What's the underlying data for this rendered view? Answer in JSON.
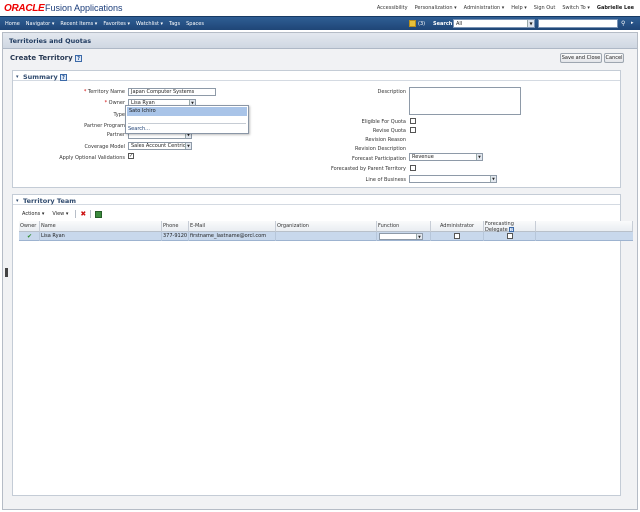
{
  "banner": {
    "logo": "ORACLE",
    "product": "Fusion Applications",
    "links": [
      "Accessibility",
      "Personalization ▾",
      "Administration ▾",
      "Help ▾",
      "Sign Out",
      "Switch To ▾"
    ],
    "user": "Gabrielle Lee"
  },
  "navbar": {
    "items": [
      "Home",
      "Navigator ▾",
      "Recent Items ▾",
      "Favorites ▾",
      "Watchlist ▾",
      "Tags",
      "Spaces"
    ],
    "flag_count": "(3)",
    "search_label": "Search",
    "search_scope": "All",
    "search_value": ""
  },
  "page": {
    "title": "Territories and Quotas",
    "task_title": "Create Territory",
    "buttons": {
      "save_close": "Save and Close",
      "cancel": "Cancel"
    }
  },
  "summary": {
    "title": "Summary",
    "left_labels": {
      "territory_name": "Territory Name",
      "owner": "Owner",
      "type": "Type",
      "partner_program": "Partner Program",
      "partner": "Partner",
      "coverage_model": "Coverage Model",
      "apply_optional": "Apply Optional Validations"
    },
    "values": {
      "territory_name": "Japan Computer Systems",
      "owner": "Lisa Ryan",
      "coverage_model": "Sales Account Centric",
      "forecast_participation": "Revenue"
    },
    "owner_popup": {
      "highlighted": "Sato Ichiro",
      "search": "Search..."
    },
    "right_labels": {
      "description": "Description",
      "eligible_quota": "Eligible For Quota",
      "revise_quota": "Revise Quota",
      "revision_reason": "Revision Reason",
      "revision_description": "Revision Description",
      "forecast_participation": "Forecast Participation",
      "forecasted_by_parent": "Forecasted by Parent Territory",
      "line_of_business": "Line of Business"
    }
  },
  "team": {
    "title": "Territory Team",
    "toolbar": {
      "actions": "Actions ▾",
      "view": "View ▾"
    },
    "columns": [
      "Owner",
      "Name",
      "Phone",
      "E-Mail",
      "Organization",
      "Function",
      "Administrator",
      "Forecasting Delegate"
    ],
    "row": {
      "name": "Lisa Ryan",
      "phone": "377-9120",
      "email": "firstname_lastname@orcl.com",
      "organization": "",
      "function": ""
    }
  }
}
